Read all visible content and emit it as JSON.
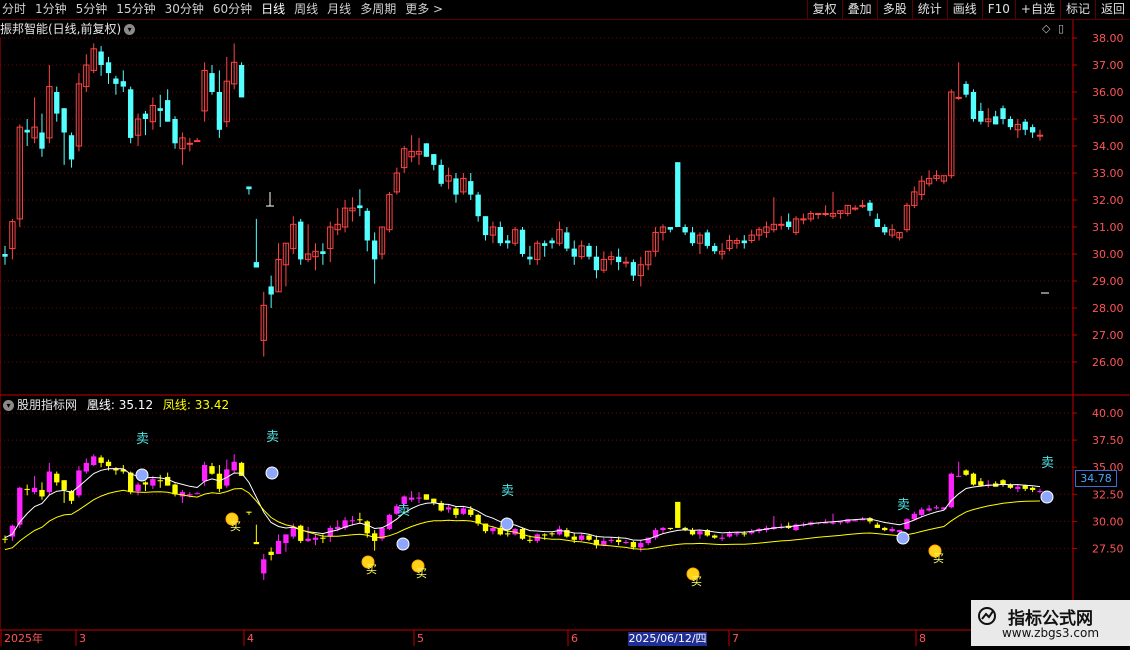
{
  "toolbar": {
    "periods": [
      "分时",
      "1分钟",
      "5分钟",
      "15分钟",
      "30分钟",
      "60分钟",
      "日线",
      "周线",
      "月线",
      "多周期",
      "更多"
    ],
    "active_period": "日线",
    "more_arrow": ">",
    "buttons": [
      "复权",
      "叠加",
      "多股",
      "统计",
      "画线",
      "F10",
      "+自选",
      "标记",
      "返回"
    ]
  },
  "main_pane": {
    "title": "振邦智能(日线,前复权)",
    "toggle_icon": "chevron-down-icon",
    "y_ticks": [
      "38.00",
      "37.00",
      "36.00",
      "35.00",
      "34.00",
      "33.00",
      "32.00",
      "31.00",
      "30.00",
      "29.00",
      "28.00",
      "27.00",
      "26.00"
    ],
    "icons": [
      "diamond-icon",
      "panel-toggle-icon"
    ]
  },
  "indicator_pane": {
    "title": "股朋指标网",
    "toggle_icon": "chevron-down-icon",
    "line1_label": "凰线:",
    "line1_value": "35.12",
    "line2_label": "凤线:",
    "line2_value": "33.42",
    "y_ticks": [
      "40.00",
      "37.50",
      "35.00",
      "32.50",
      "30.00",
      "27.50"
    ],
    "current_value": "34.78",
    "sell_label": "卖",
    "buy_label": "买"
  },
  "date_axis": {
    "labels": [
      "2025年",
      "3",
      "4",
      "5",
      "6",
      "7",
      "8"
    ],
    "highlight": "2025/06/12/四"
  },
  "watermark": {
    "title": "指标公式网",
    "url": "www.zbgs3.com"
  },
  "colors": {
    "up": "#ff4444",
    "down": "#54ffff",
    "ind_up": "#ff22ff",
    "ind_down": "#ffff00",
    "line_white": "#ffffff",
    "line_yellow": "#ffff00",
    "axis_red": "#c00000",
    "grid": "#7a0000"
  }
}
